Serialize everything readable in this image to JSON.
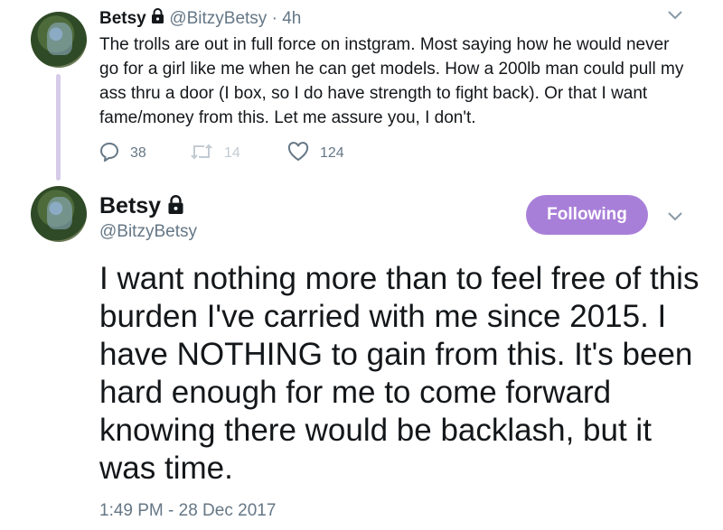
{
  "tweet_reply": {
    "display_name": "Betsy",
    "handle": "@BitzyBetsy",
    "separator": "·",
    "age": "4h",
    "text": "The trolls are out in full force on instgram. Most saying how he would never go for a girl like me when he can get models. How a 200lb man could pull my ass thru a door (I box, so I do have strength to fight back). Or that I want fame/money from this. Let me assure you, I don't.",
    "replies": "38",
    "retweets": "14",
    "likes": "124",
    "icons": [
      "reply-icon",
      "retweet-icon",
      "like-icon",
      "lock-icon",
      "chevron-down-icon"
    ]
  },
  "tweet_main": {
    "display_name": "Betsy",
    "handle": "@BitzyBetsy",
    "follow_label": "Following",
    "text": "I want nothing more than to feel free of this burden I've carried with me since 2015. I have NOTHING to gain from this. It's been hard enough for me to come forward knowing there would be backlash, but it was time.",
    "timestamp": "1:49 PM - 28 Dec 2017"
  },
  "colors": {
    "follow_button": "#a87fd8",
    "thread_line": "#d6cbe8",
    "muted_text": "#657786"
  }
}
